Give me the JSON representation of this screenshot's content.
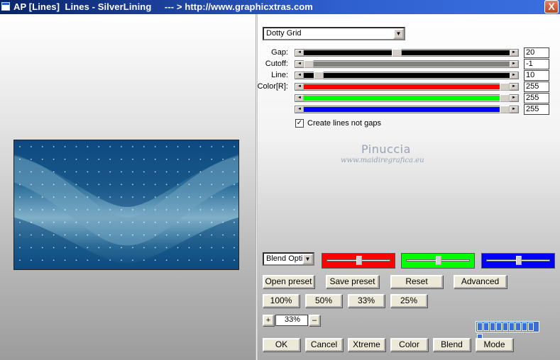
{
  "window": {
    "title": "AP [Lines]  Lines - SilverLining     --- > http://www.graphicxtras.com",
    "close_label": "X"
  },
  "preset_select": {
    "value": "Dotty Grid"
  },
  "sliders": [
    {
      "label": "Gap:",
      "value": "20",
      "level": 0.45,
      "color": "#000000"
    },
    {
      "label": "Cutoff:",
      "value": "-1",
      "level": 0.0,
      "color": "#808080"
    },
    {
      "label": "Line:",
      "value": "10",
      "level": 0.05,
      "color": "#000000"
    },
    {
      "label": "Color[R]:",
      "value": "255",
      "level": 1.0,
      "color": "#ff0000"
    },
    {
      "label": "",
      "value": "255",
      "level": 1.0,
      "color": "#00ff00"
    },
    {
      "label": "",
      "value": "255",
      "level": 1.0,
      "color": "#0000ff"
    }
  ],
  "checkbox": {
    "label": "Create lines not gaps",
    "checked": true,
    "mark": "✓"
  },
  "watermark": {
    "name": "Pinuccia",
    "url": "www.maidiregrafica.eu"
  },
  "blend_select": {
    "value": "Blend Optio"
  },
  "color_bars": [
    {
      "color": "#ff0000",
      "level": 0.5
    },
    {
      "color": "#00ff00",
      "level": 0.5
    },
    {
      "color": "#0000ff",
      "level": 0.5
    }
  ],
  "buttons": {
    "open_preset": "Open preset",
    "save_preset": "Save preset",
    "reset": "Reset",
    "advanced": "Advanced",
    "z100": "100%",
    "z50": "50%",
    "z33": "33%",
    "z25": "25%",
    "ok": "OK",
    "cancel": "Cancel",
    "xtreme": "Xtreme",
    "color": "Color",
    "blend": "Blend",
    "mode": "Mode"
  },
  "zoom": {
    "plus": "+",
    "value": "33%",
    "minus": "–"
  },
  "progress": {
    "segments": 10
  },
  "colors": {
    "preview_dark": "#0d4a80",
    "preview_light": "#7fb0c9",
    "titlebar": "#0a246a"
  }
}
